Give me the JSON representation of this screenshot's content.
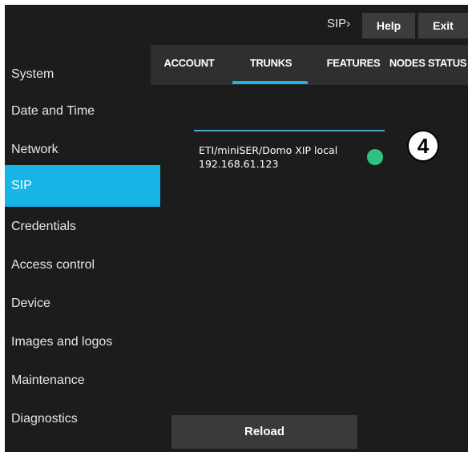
{
  "header": {
    "breadcrumb": "SIP›",
    "help_label": "Help",
    "exit_label": "Exit"
  },
  "sidebar": {
    "items": [
      {
        "label": "System"
      },
      {
        "label": "Date and Time"
      },
      {
        "label": "Network"
      },
      {
        "label": "SIP"
      },
      {
        "label": "Credentials"
      },
      {
        "label": "Access control"
      },
      {
        "label": "Device"
      },
      {
        "label": "Images and logos"
      },
      {
        "label": "Maintenance"
      },
      {
        "label": "Diagnostics"
      }
    ],
    "active_item": "SIP"
  },
  "tabs": {
    "items": [
      {
        "label": "ACCOUNT"
      },
      {
        "label": "TRUNKS"
      },
      {
        "label": "FEATURES"
      },
      {
        "label": "NODES STATUS"
      }
    ],
    "active_tab": "TRUNKS"
  },
  "trunk": {
    "name": "ETI/miniSER/Domo XIP local",
    "ip": "192.168.61.123",
    "status_color": "#2ec27e"
  },
  "callout": {
    "number": "4"
  },
  "footer": {
    "reload_label": "Reload"
  },
  "colors": {
    "accent": "#18b4e6",
    "background": "#1c1c1c",
    "tab_bar": "#2f2f2f",
    "button": "#3c3c3c"
  }
}
